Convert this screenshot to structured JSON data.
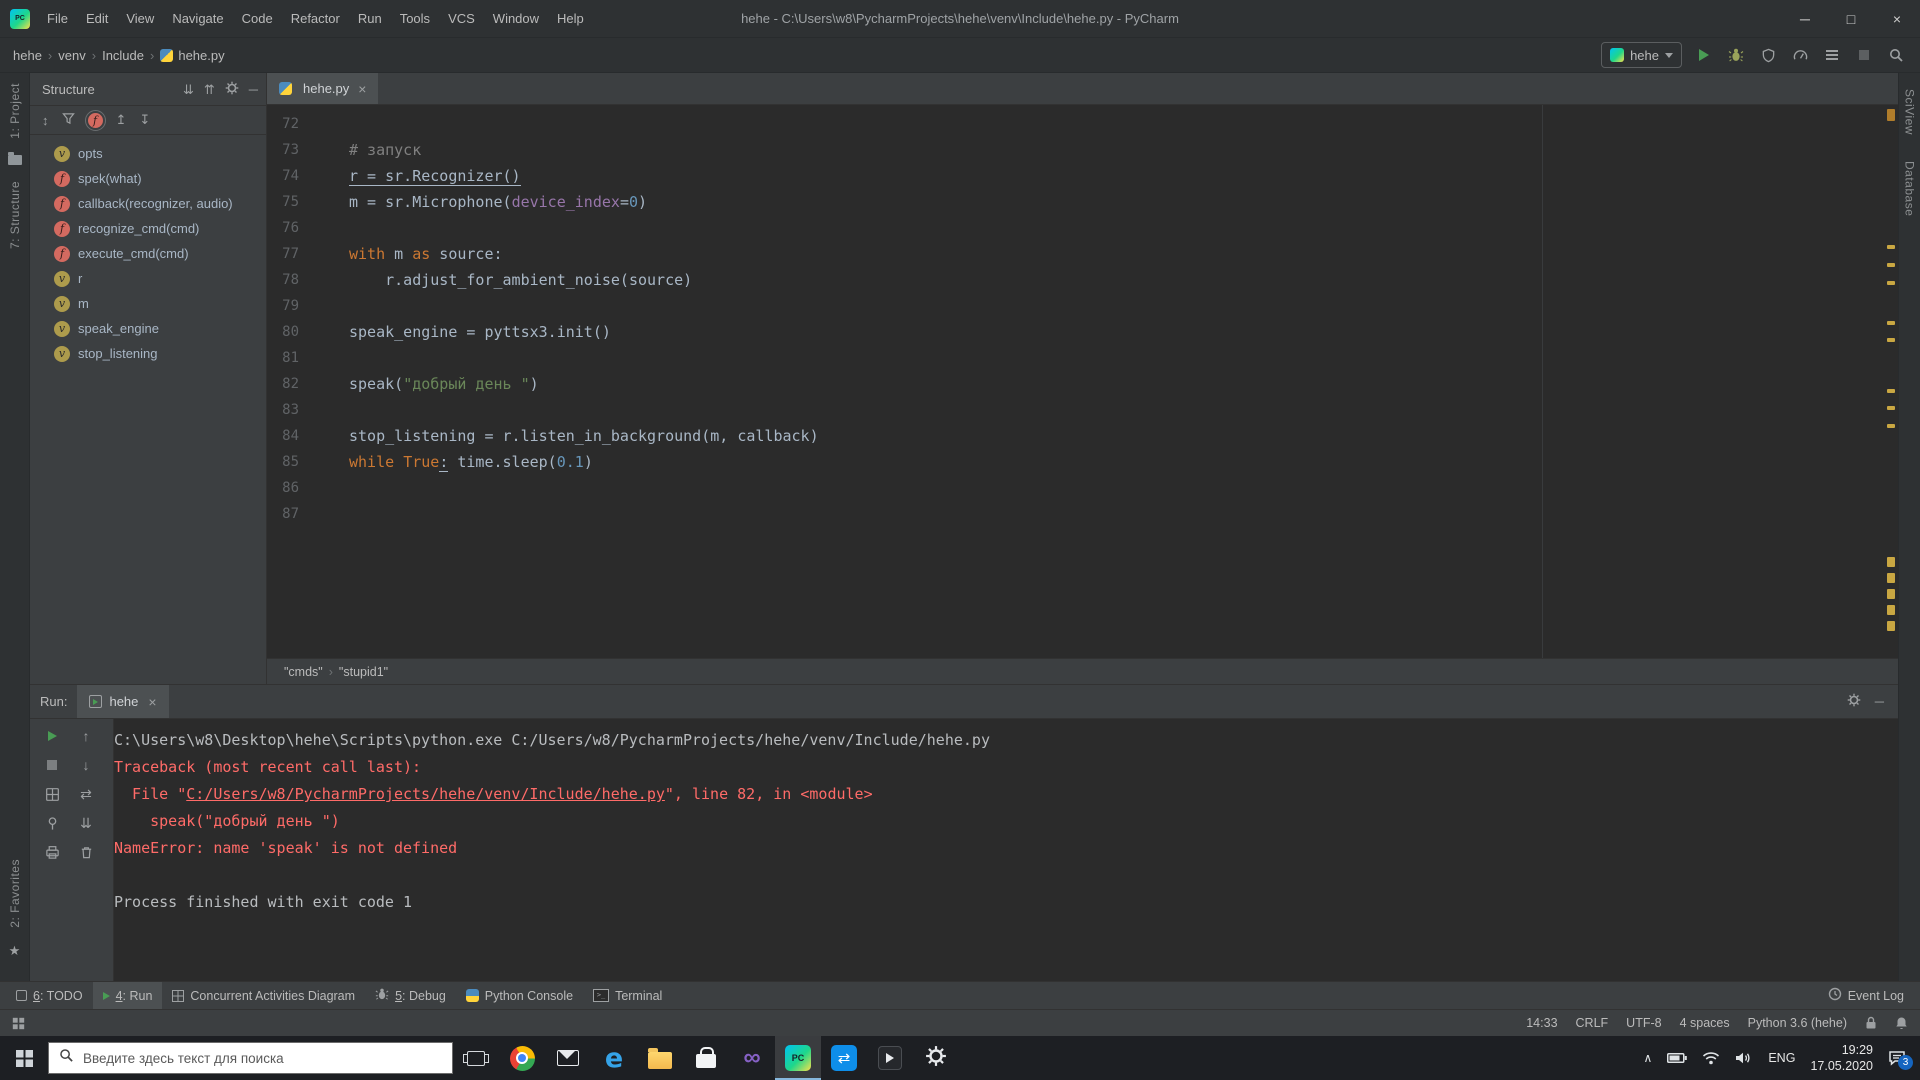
{
  "colors": {
    "keyword": "#cc7832",
    "string": "#6a8759",
    "number": "#6897bb",
    "comment": "#808080",
    "parameter": "#9876aa",
    "error": "#ff6b68",
    "foreground": "#a9b7c6",
    "run_green": "#499c54",
    "editor_bg": "#2b2b2b",
    "panel_bg": "#3c3f41",
    "taskbar_bg": "#1d1f23"
  },
  "title_bar": {
    "menus": [
      "File",
      "Edit",
      "View",
      "Navigate",
      "Code",
      "Refactor",
      "Run",
      "Tools",
      "VCS",
      "Window",
      "Help"
    ],
    "title": "hehe - C:\\Users\\w8\\PycharmProjects\\hehe\\venv\\Include\\hehe.py - PyCharm"
  },
  "nav_bar": {
    "breadcrumbs": [
      "hehe",
      "venv",
      "Include",
      "hehe.py"
    ],
    "run_config": "hehe"
  },
  "tool_strips": {
    "left_top": [
      "1: Project",
      "7: Structure"
    ],
    "left_bottom": [
      "2: Favorites"
    ],
    "right": [
      "SciView",
      "Database"
    ]
  },
  "structure_panel": {
    "title": "Structure",
    "items": [
      {
        "label": "opts",
        "kind": "v"
      },
      {
        "label": "spek(what)",
        "kind": "f"
      },
      {
        "label": "callback(recognizer, audio)",
        "kind": "f"
      },
      {
        "label": "recognize_cmd(cmd)",
        "kind": "f"
      },
      {
        "label": "execute_cmd(cmd)",
        "kind": "f"
      },
      {
        "label": "r",
        "kind": "v"
      },
      {
        "label": "m",
        "kind": "v"
      },
      {
        "label": "speak_engine",
        "kind": "v"
      },
      {
        "label": "stop_listening",
        "kind": "v"
      }
    ]
  },
  "editor": {
    "tab": "hehe.py",
    "breadcrumbs": [
      "\"cmds\"",
      "\"stupid1\""
    ],
    "lines": [
      {
        "no": "72",
        "segments": []
      },
      {
        "no": "73",
        "segments": [
          {
            "t": "# запуск",
            "c": "comment"
          }
        ]
      },
      {
        "no": "74",
        "segments": [
          {
            "t": "r = sr.Recognizer()",
            "c": "default",
            "u": true
          }
        ]
      },
      {
        "no": "75",
        "segments": [
          {
            "t": "m = sr.Microphone(",
            "c": "default"
          },
          {
            "t": "device_index",
            "c": "param"
          },
          {
            "t": "=",
            "c": "default"
          },
          {
            "t": "0",
            "c": "number"
          },
          {
            "t": ")",
            "c": "default"
          }
        ]
      },
      {
        "no": "76",
        "segments": []
      },
      {
        "no": "77",
        "segments": [
          {
            "t": "with",
            "c": "keyword"
          },
          {
            "t": " m ",
            "c": "default"
          },
          {
            "t": "as",
            "c": "keyword"
          },
          {
            "t": " source:",
            "c": "default"
          }
        ]
      },
      {
        "no": "78",
        "segments": [
          {
            "t": "    r.adjust_for_ambient_noise(source)",
            "c": "default"
          }
        ]
      },
      {
        "no": "79",
        "segments": []
      },
      {
        "no": "80",
        "segments": [
          {
            "t": "speak_engine = pyttsx3.init()",
            "c": "default"
          }
        ]
      },
      {
        "no": "81",
        "segments": []
      },
      {
        "no": "82",
        "segments": [
          {
            "t": "speak(",
            "c": "default"
          },
          {
            "t": "\"добрый день \"",
            "c": "string"
          },
          {
            "t": ")",
            "c": "default"
          }
        ]
      },
      {
        "no": "83",
        "segments": []
      },
      {
        "no": "84",
        "segments": [
          {
            "t": "stop_listening = r.listen_in_background(m, callback)",
            "c": "default"
          }
        ]
      },
      {
        "no": "85",
        "segments": [
          {
            "t": "while",
            "c": "keyword"
          },
          {
            "t": " ",
            "c": "default"
          },
          {
            "t": "True",
            "c": "keyword"
          },
          {
            "t": ":",
            "c": "default",
            "u": true
          },
          {
            "t": " time.sleep(",
            "c": "default"
          },
          {
            "t": "0.1",
            "c": "number"
          },
          {
            "t": ")",
            "c": "default"
          }
        ]
      },
      {
        "no": "86",
        "segments": []
      },
      {
        "no": "87",
        "segments": []
      }
    ]
  },
  "run_panel": {
    "label": "Run:",
    "tab": "hehe",
    "console": [
      {
        "segments": [
          {
            "t": "C:\\Users\\w8\\Desktop\\hehe\\Scripts\\python.exe C:/Users/w8/PycharmProjects/hehe/venv/Include/hehe.py",
            "c": "out"
          }
        ]
      },
      {
        "segments": [
          {
            "t": "Traceback (most recent call last):",
            "c": "err"
          }
        ]
      },
      {
        "segments": [
          {
            "t": "  File \"",
            "c": "err"
          },
          {
            "t": "C:/Users/w8/PycharmProjects/hehe/venv/Include/hehe.py",
            "c": "errlink"
          },
          {
            "t": "\", line 82, in <module>",
            "c": "err"
          }
        ]
      },
      {
        "segments": [
          {
            "t": "    speak(\"добрый день \")",
            "c": "err"
          }
        ]
      },
      {
        "segments": [
          {
            "t": "NameError: name 'speak' is not defined",
            "c": "err"
          }
        ]
      },
      {
        "segments": []
      },
      {
        "segments": [
          {
            "t": "Process finished with exit code 1",
            "c": "out"
          }
        ]
      }
    ]
  },
  "tool_window_bar": {
    "left": [
      {
        "label": "6: TODO",
        "icon": "todo",
        "mnemonic": "6"
      },
      {
        "label": "4: Run",
        "icon": "run",
        "mnemonic": "4",
        "active": true
      },
      {
        "label": "Concurrent Activities Diagram",
        "icon": "diagram"
      },
      {
        "label": "5: Debug",
        "icon": "debug",
        "mnemonic": "5"
      },
      {
        "label": "Python Console",
        "icon": "python"
      },
      {
        "label": "Terminal",
        "icon": "terminal"
      }
    ],
    "right": [
      {
        "label": "Event Log",
        "icon": "event-log"
      }
    ]
  },
  "status_bar": {
    "items": [
      "14:33",
      "CRLF",
      "UTF-8",
      "4 spaces",
      "Python 3.6 (hehe)"
    ]
  },
  "taskbar": {
    "search_placeholder": "Введите здесь текст для поиска",
    "apps": [
      {
        "name": "chrome"
      },
      {
        "name": "mail"
      },
      {
        "name": "edge"
      },
      {
        "name": "file-explorer"
      },
      {
        "name": "store"
      },
      {
        "name": "visual-studio"
      },
      {
        "name": "pycharm",
        "active": true
      },
      {
        "name": "teamviewer"
      },
      {
        "name": "media"
      },
      {
        "name": "settings"
      }
    ],
    "tray": {
      "language": "ENG",
      "time": "19:29",
      "date": "17.05.2020",
      "notification_count": "3"
    }
  }
}
